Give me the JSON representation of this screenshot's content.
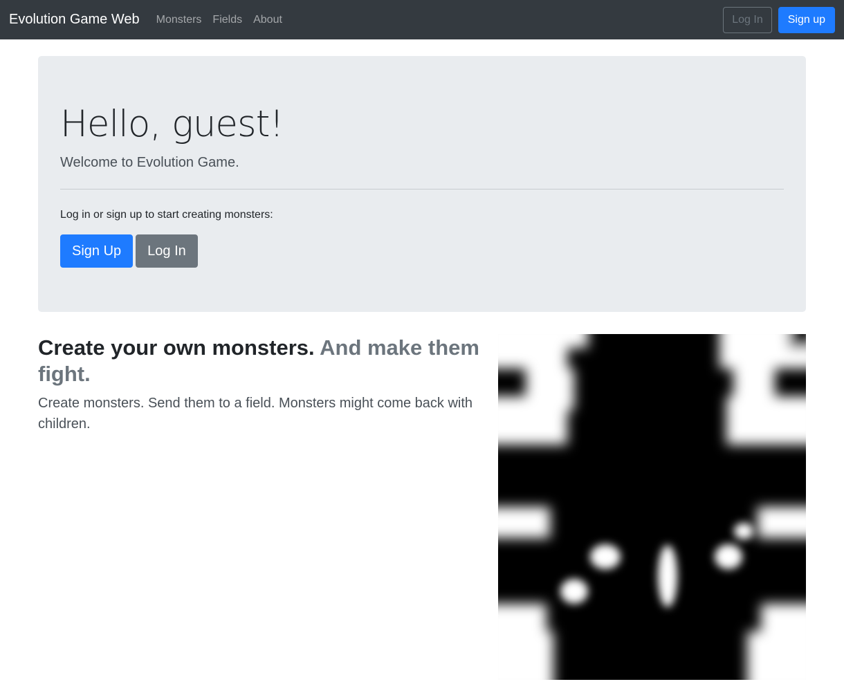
{
  "navbar": {
    "brand": "Evolution Game Web",
    "links": [
      "Monsters",
      "Fields",
      "About"
    ],
    "login_label": "Log In",
    "signup_label": "Sign up"
  },
  "jumbotron": {
    "title": "Hello, guest!",
    "lead": "Welcome to Evolution Game.",
    "prompt": "Log in or sign up to start creating monsters:",
    "signup_label": "Sign Up",
    "login_label": "Log In"
  },
  "feature": {
    "heading": "Create your own monsters.",
    "heading_muted": "And make them fight.",
    "lead": "Create monsters. Send them to a field. Monsters might come back with children."
  },
  "colors": {
    "navbar_bg": "#343a40",
    "primary": "#1e7bff",
    "secondary": "#6c757d",
    "jumbotron_bg": "#e9ecef"
  }
}
